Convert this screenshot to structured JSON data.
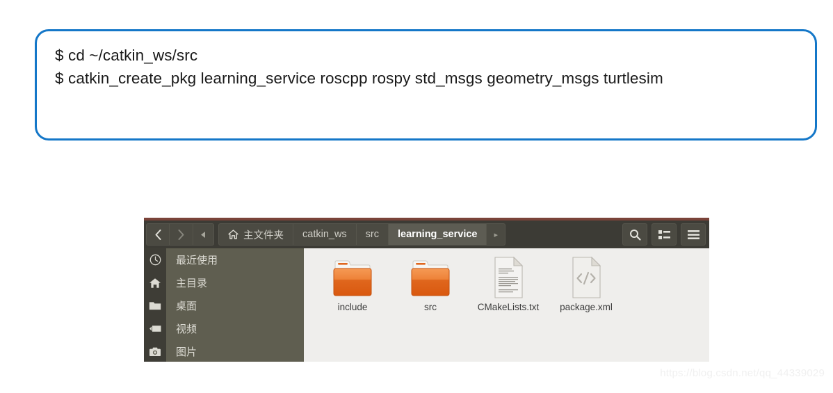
{
  "command_box": {
    "border_color": "#1477c8",
    "lines": [
      "$ cd ~/catkin_ws/src",
      "$ catkin_create_pkg learning_service roscpp rospy std_msgs geometry_msgs turtlesim"
    ]
  },
  "file_manager": {
    "toolbar": {
      "back_label": "‹",
      "forward_label": "›",
      "up_label": "◂",
      "search_label": "search-icon",
      "view_label": "list-view-icon",
      "menu_label": "hamburger-menu-icon",
      "breadcrumbs": [
        {
          "label": "主文件夹",
          "icon": "home-icon",
          "active": false
        },
        {
          "label": "catkin_ws",
          "icon": "",
          "active": false
        },
        {
          "label": "src",
          "icon": "",
          "active": false
        },
        {
          "label": "learning_service",
          "icon": "",
          "active": true
        }
      ],
      "breadcrumb_next": "▸"
    },
    "sidebar": {
      "items": [
        {
          "label": "最近使用",
          "icon": "clock-icon"
        },
        {
          "label": "主目录",
          "icon": "home-icon"
        },
        {
          "label": "桌面",
          "icon": "folder-icon"
        },
        {
          "label": "视频",
          "icon": "video-icon"
        },
        {
          "label": "图片",
          "icon": "camera-icon"
        }
      ]
    },
    "files": [
      {
        "name": "include",
        "type": "folder"
      },
      {
        "name": "src",
        "type": "folder"
      },
      {
        "name": "CMakeLists.txt",
        "type": "text-document"
      },
      {
        "name": "package.xml",
        "type": "xml-document"
      }
    ],
    "colors": {
      "toolbar_bg": "#3c3b35",
      "sidebar_bg": "#5f5e50",
      "sidebar_strip_bg": "#3e3d36",
      "content_bg": "#efeeec",
      "folder_color": "#e8762a"
    }
  },
  "watermark": {
    "text": "https://blog.csdn.net/qq_44339029"
  }
}
